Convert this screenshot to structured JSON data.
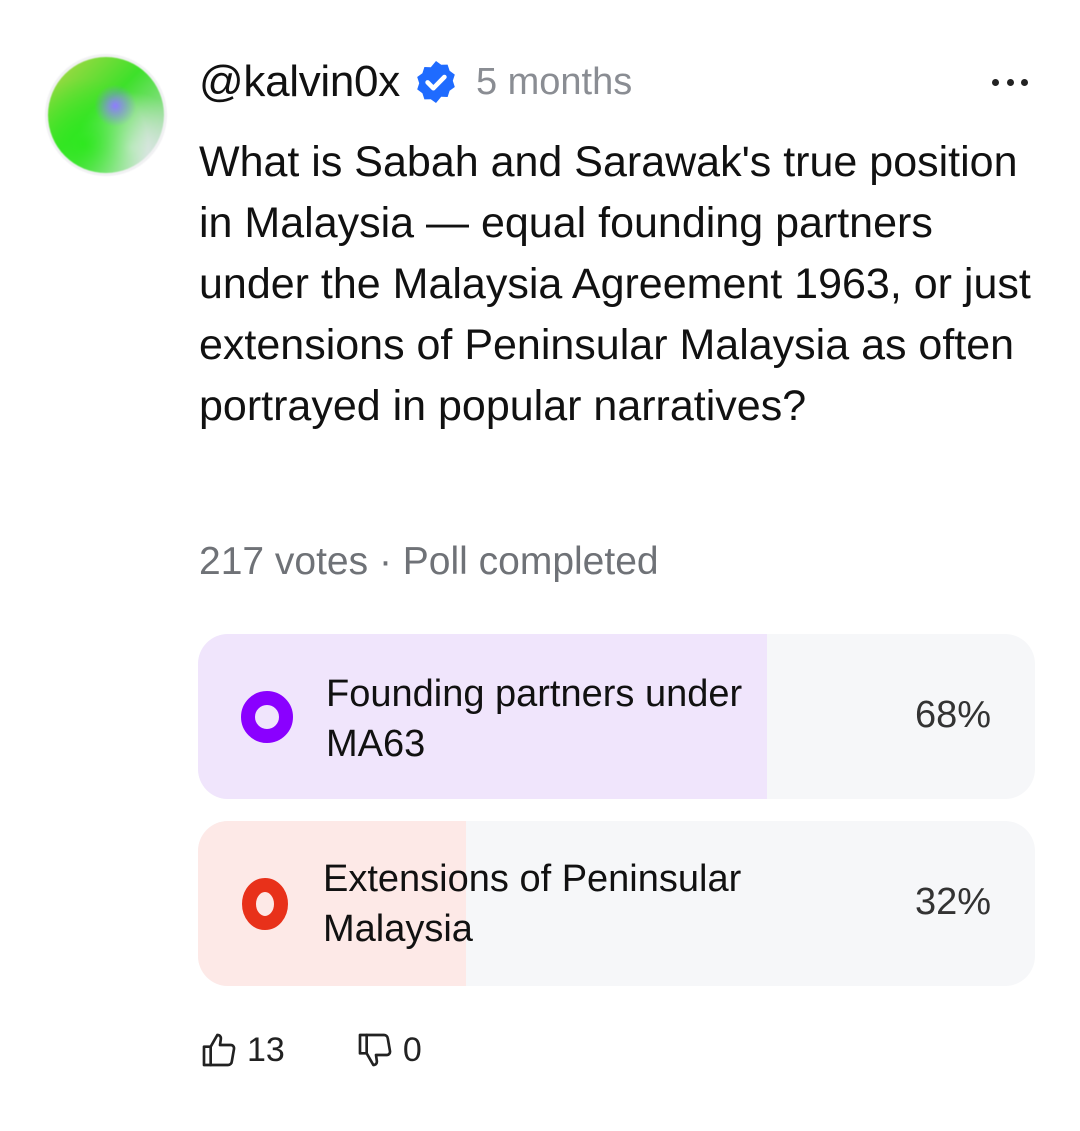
{
  "post": {
    "username": "@kalvin0x",
    "timestamp": "5 months",
    "question": "What is Sabah and Sarawak's true position in Malaysia — equal founding partners under the Malaysia Agreement 1963, or just extensions of Peninsular Malaysia as often portrayed in popular narratives?"
  },
  "poll": {
    "meta": "217 votes · Poll completed",
    "options": [
      {
        "label": "Founding partners under MA63",
        "percent_label": "68%",
        "percent": 68,
        "color": "#8a00ff"
      },
      {
        "label": "Extensions of Peninsular Malaysia",
        "percent_label": "32%",
        "percent": 32,
        "color": "#e8311a"
      }
    ]
  },
  "reactions": {
    "likes": "13",
    "dislikes": "0"
  },
  "icons": {
    "verified": "verified-badge-icon",
    "more": "more-horizontal-icon",
    "like": "thumbs-up-icon",
    "dislike": "thumbs-down-icon"
  },
  "colors": {
    "verified": "#1f6bff",
    "option1_fill": "#f0e5fc",
    "option2_fill": "#fde9e7",
    "track": "#f6f7f9"
  }
}
